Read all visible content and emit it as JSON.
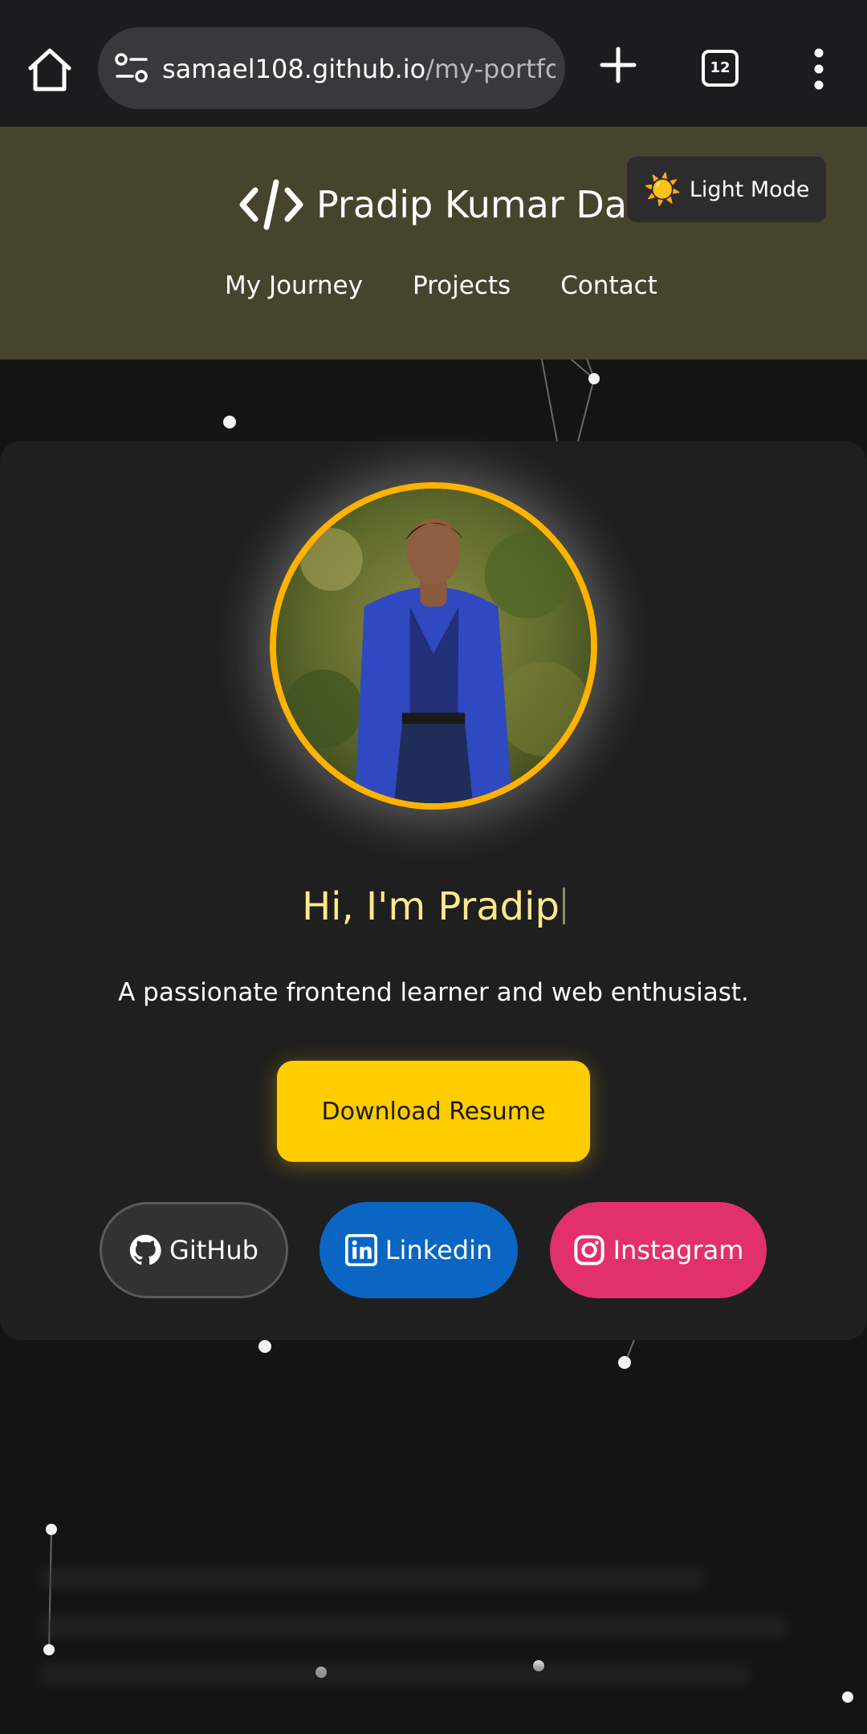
{
  "browser": {
    "url_host": "samael108.github.io",
    "url_path": "/my-portfolio/",
    "tab_count": "12",
    "icons": [
      "home-icon",
      "site-settings-icon",
      "plus-icon",
      "tab-switcher-icon",
      "more-vert-icon"
    ]
  },
  "header": {
    "brand_name": "Pradip Kumar Das",
    "brand_icon": "code-icon",
    "theme_toggle": {
      "icon": "☀️",
      "label": "Light Mode"
    },
    "nav": [
      "My Journey",
      "Projects",
      "Contact"
    ],
    "background_color": "#47442e"
  },
  "hero": {
    "heading": "Hi, I'm Pradip",
    "subtitle": "A passionate frontend learner and web enthusiast.",
    "resume_button": "Download Resume",
    "avatar_ring_color": "#ffb300",
    "resume_button_color": "#ffcc00"
  },
  "social": {
    "github": {
      "label": "GitHub",
      "icon": "github-icon",
      "color": "#323232"
    },
    "linkedin": {
      "label": "Linkedin",
      "icon": "linkedin-icon",
      "color": "#0a66c2"
    },
    "instagram": {
      "label": "Instagram",
      "icon": "instagram-icon",
      "color": "#e1306c"
    }
  }
}
